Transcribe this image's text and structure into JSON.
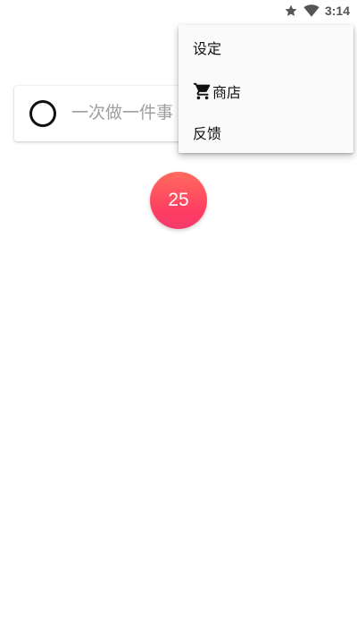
{
  "status_bar": {
    "time": "3:14",
    "icons": [
      "star-icon",
      "wifi-icon"
    ]
  },
  "task_card": {
    "placeholder": "一次做一件事",
    "value": ""
  },
  "pomodoro": {
    "count": "25",
    "color_top": "#ff6b5e",
    "color_bottom": "#f33a6a"
  },
  "overflow_menu": {
    "items": [
      {
        "label": "设定",
        "icon": ""
      },
      {
        "label": "商店",
        "icon": "cart-icon"
      },
      {
        "label": "反馈",
        "icon": ""
      }
    ]
  }
}
